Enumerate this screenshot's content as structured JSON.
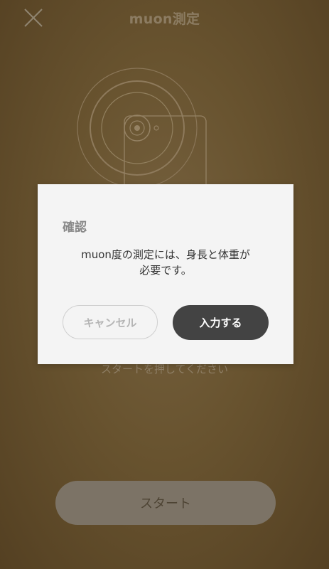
{
  "header": {
    "title": "muon測定",
    "close_icon": "close-icon"
  },
  "main": {
    "illustration_icon": "phone-pulse-icon",
    "instruction": "スタートを押してください",
    "start_label": "スタート"
  },
  "dialog": {
    "title": "確認",
    "message_line1": "muon度の測定には、身長と体重が",
    "message_line2": "必要です。",
    "cancel_label": "キャンセル",
    "confirm_label": "入力する"
  },
  "colors": {
    "background": "#68532f",
    "dialog_bg": "#f4f4f4",
    "confirm_bg": "#434343",
    "start_bg": "#7c7366"
  }
}
